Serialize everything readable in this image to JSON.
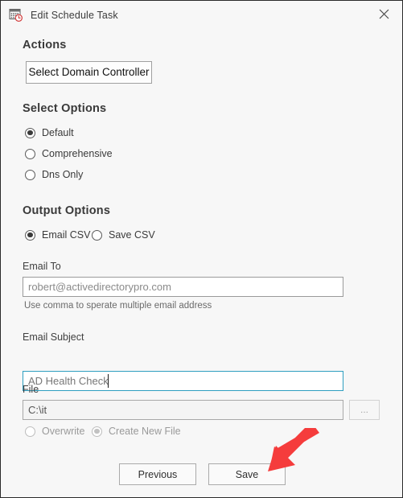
{
  "window": {
    "title": "Edit Schedule Task",
    "icon": "schedule-task-icon",
    "close_icon": "close-icon",
    "border_color": "#2b2b2b",
    "background": "#f7f7f7"
  },
  "actions": {
    "heading": "Actions",
    "select_dc_button": "Select Domain Controller"
  },
  "select_options": {
    "heading": "Select Options",
    "items": [
      {
        "label": "Default",
        "selected": true,
        "disabled": false
      },
      {
        "label": "Comprehensive",
        "selected": false,
        "disabled": false
      },
      {
        "label": "Dns Only",
        "selected": false,
        "disabled": false
      }
    ]
  },
  "output_options": {
    "heading": "Output Options",
    "items": [
      {
        "label": "Email CSV",
        "selected": true,
        "disabled": false
      },
      {
        "label": "Save CSV",
        "selected": false,
        "disabled": false
      }
    ]
  },
  "email_to": {
    "label": "Email To",
    "value": "robert@activedirectorypro.com",
    "placeholder": "robert@activedirectorypro.com",
    "hint": "Use comma to sperate multiple email address"
  },
  "email_subject": {
    "label": "Email Subject",
    "value": "AD Health Check",
    "placeholder": "AD Health Check",
    "focused": true,
    "focus_color": "#2e9ec0"
  },
  "file": {
    "label": "File",
    "value": "C:\\it",
    "placeholder": "C:\\it",
    "browse_button": "...",
    "disabled": true,
    "items": [
      {
        "label": "Overwrite",
        "selected": false,
        "disabled": true
      },
      {
        "label": "Create New File",
        "selected": true,
        "disabled": true
      }
    ]
  },
  "footer": {
    "previous_label": "Previous",
    "save_label": "Save"
  },
  "annotation": {
    "name": "red-arrow-pointing-to-save",
    "color": "#f53c3c"
  }
}
